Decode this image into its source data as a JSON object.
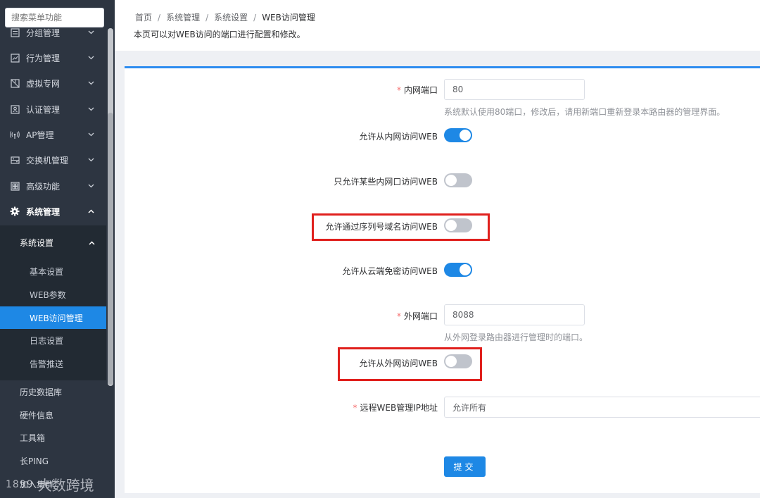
{
  "search": {
    "placeholder": "搜索菜单功能"
  },
  "sidebar": {
    "items": [
      {
        "label": "分组管理",
        "icon": "group-icon"
      },
      {
        "label": "行为管理",
        "icon": "behavior-icon"
      },
      {
        "label": "虚拟专网",
        "icon": "vpn-icon"
      },
      {
        "label": "认证管理",
        "icon": "auth-icon"
      },
      {
        "label": "AP管理",
        "icon": "ap-icon"
      },
      {
        "label": "交换机管理",
        "icon": "switch-icon"
      },
      {
        "label": "高级功能",
        "icon": "advanced-icon"
      },
      {
        "label": "系统管理",
        "icon": "gear-icon"
      }
    ],
    "submenu_title": "系统设置",
    "submenu": [
      "基本设置",
      "WEB参数",
      "WEB访问管理",
      "日志设置",
      "告警推送"
    ],
    "active_item": "WEB访问管理",
    "extra": [
      "历史数据库",
      "硬件信息",
      "工具箱",
      "长PING",
      "加入集群"
    ]
  },
  "watermark": {
    "logo": "1899",
    "text": "大数跨境"
  },
  "header": {
    "breadcrumb": [
      "首页",
      "系统管理",
      "系统设置",
      "WEB访问管理"
    ],
    "separator": "/",
    "description": "本页可以对WEB访问的端口进行配置和修改。"
  },
  "form": {
    "lan_port": {
      "label": "内网端口",
      "value": "80",
      "hint": "系统默认使用80端口，修改后，请用新端口重新登录本路由器的管理界面。"
    },
    "allow_lan_web": {
      "label": "允许从内网访问WEB",
      "on": true
    },
    "allow_some_lan": {
      "label": "只允许某些内网口访问WEB",
      "on": false
    },
    "allow_serial_domain": {
      "label": "允许通过序列号域名访问WEB",
      "on": false
    },
    "allow_cloud": {
      "label": "允许从云端免密访问WEB",
      "on": true
    },
    "wan_port": {
      "label": "外网端口",
      "value": "8088",
      "hint": "从外网登录路由器进行管理时的端口。"
    },
    "allow_wan_web": {
      "label": "允许从外网访问WEB",
      "on": false
    },
    "remote_ip": {
      "label": "远程WEB管理IP地址",
      "value": "允许所有"
    },
    "submit_label": "提交"
  },
  "colors": {
    "accent": "#1e88e5",
    "highlight": "#e0201d",
    "sidebar_bg": "#2d3541",
    "required": "#f56c6c"
  }
}
